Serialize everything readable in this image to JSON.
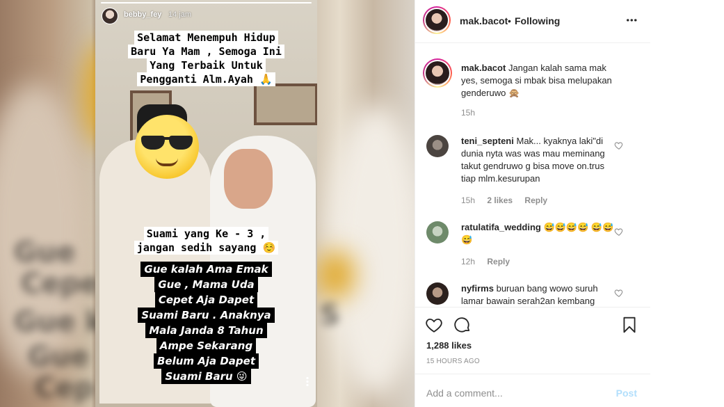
{
  "story": {
    "username": "bebby_fey",
    "time": "14 jam",
    "caption_top": [
      "Selamat Menempuh Hidup",
      "Baru Ya Mam , Semoga Ini",
      "Yang Terbaik Untuk",
      "Pengganti Alm.Ayah 🙏"
    ],
    "caption_mid": [
      "Suami yang Ke - 3 ,",
      "jangan sedih sayang ☺️"
    ],
    "caption_bottom": [
      "Gue kalah Ama Emak",
      "Gue , Mama Uda",
      "Cepet Aja Dapet",
      "Suami Baru . Anaknya",
      "Mala Janda 8 Tahun",
      "Ampe Sekarang",
      "Belum Aja Dapet",
      "Suami Baru 😜"
    ]
  },
  "header": {
    "username": "mak.bacot",
    "separator": "•",
    "follow_state": "Following"
  },
  "comments": [
    {
      "username": "mak.bacot",
      "text": "Jangan kalah sama mak yes, semoga si mbak bisa melupakan genderuwo 🙊",
      "time": "15h"
    },
    {
      "username": "teni_septeni",
      "text": "Mak... kyaknya laki\"di dunia nyta was was mau meminang takut gendruwo g bisa move on.trus tiap mlm.kesurupan",
      "time": "15h",
      "likes": "2 likes",
      "reply": "Reply"
    },
    {
      "username": "ratulatifa_wedding",
      "text": "😅😅😅😅 😅😅😅",
      "time": "12h",
      "reply": "Reply"
    },
    {
      "username": "nyfirms",
      "text": "buruan bang wowo suruh lamar bawain serah2an kembang",
      "time": ""
    }
  ],
  "post": {
    "likes": "1,288 likes",
    "time_ago": "15 HOURS AGO"
  },
  "add_comment": {
    "placeholder": "Add a comment...",
    "post_label": "Post"
  }
}
